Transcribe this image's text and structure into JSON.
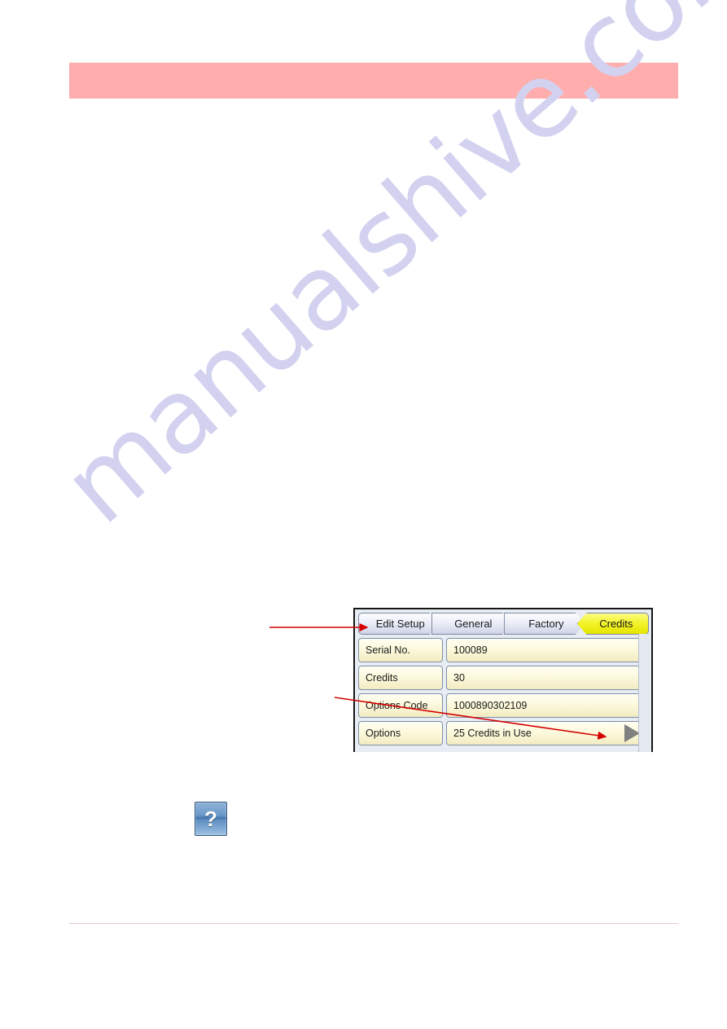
{
  "page": {
    "background_color": "#ffffff",
    "header_band_color": "#ffadad",
    "footer_rule_color": "#eec4c4",
    "watermark_text": "manualshive.com",
    "watermark_color": "#d2d2f0"
  },
  "device_panel": {
    "accent_active_color": "#f3f32e",
    "row_fill_color": "#fdfadf",
    "border_color": "#7d90ab",
    "breadcrumbs": [
      {
        "label": "Edit Setup",
        "active": false
      },
      {
        "label": "General",
        "active": false
      },
      {
        "label": "Factory",
        "active": false
      },
      {
        "label": "Credits",
        "active": true
      }
    ],
    "rows": [
      {
        "label": "Serial No.",
        "value": "100089",
        "has_next_arrow": false
      },
      {
        "label": "Credits",
        "value": "30",
        "has_next_arrow": false
      },
      {
        "label": "Options Code",
        "value": "1000890302109",
        "has_next_arrow": false
      },
      {
        "label": "Options",
        "value": "25 Credits in Use",
        "has_next_arrow": true
      }
    ],
    "next_arrow_icon": "right-triangle-icon",
    "next_arrow_color": "#808080"
  },
  "annotations": {
    "color": "#d40000",
    "arrows": [
      {
        "name": "arrow-to-edit-setup-tab",
        "target": "Edit Setup"
      },
      {
        "name": "arrow-to-options-next-button",
        "target": "Options next arrow"
      }
    ]
  },
  "help_button": {
    "icon": "question-mark-icon",
    "glyph": "?",
    "color": "#3f74ae"
  }
}
